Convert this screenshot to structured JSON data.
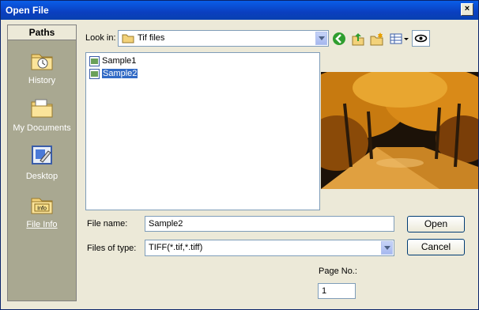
{
  "window": {
    "title": "Open File",
    "close_glyph": "×"
  },
  "sidebar": {
    "header": "Paths",
    "items": [
      {
        "label": "History",
        "icon": "history-folder-icon"
      },
      {
        "label": "My Documents",
        "icon": "my-documents-folder-icon"
      },
      {
        "label": "Desktop",
        "icon": "desktop-icon"
      },
      {
        "label": "File Info",
        "icon": "file-info-icon"
      }
    ]
  },
  "look_in": {
    "label": "Look in:",
    "value": "Tif files"
  },
  "files": [
    {
      "name": "Sample1",
      "selected": false
    },
    {
      "name": "Sample2",
      "selected": true
    }
  ],
  "file_name": {
    "label": "File name:",
    "value": "Sample2"
  },
  "file_type": {
    "label": "Files of type:",
    "value": "TIFF(*.tif,*.tiff)"
  },
  "buttons": {
    "open": "Open",
    "cancel": "Cancel"
  },
  "page": {
    "label": "Page No.:",
    "value": "1"
  },
  "colors": {
    "selection": "#316ac5",
    "sidebar": "#a9a891",
    "titlebar": "#0a3fc0"
  }
}
